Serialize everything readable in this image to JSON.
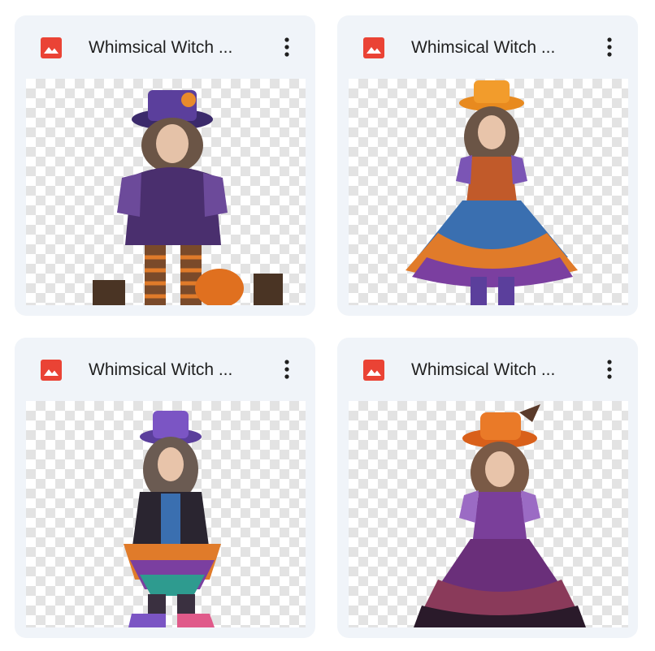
{
  "files": [
    {
      "title": "Whimsical Witch ...",
      "icon": "image-file-icon",
      "icon_color": "#ea4335"
    },
    {
      "title": "Whimsical Witch ...",
      "icon": "image-file-icon",
      "icon_color": "#ea4335"
    },
    {
      "title": "Whimsical Witch ...",
      "icon": "image-file-icon",
      "icon_color": "#ea4335"
    },
    {
      "title": "Whimsical Witch ...",
      "icon": "image-file-icon",
      "icon_color": "#ea4335"
    }
  ],
  "menu_icon": "more-vert-icon",
  "colors": {
    "card_background": "#f0f4f9",
    "title_text": "#1f1f1f",
    "checker_light": "#ffffff",
    "checker_dark": "#e3e3e3"
  }
}
